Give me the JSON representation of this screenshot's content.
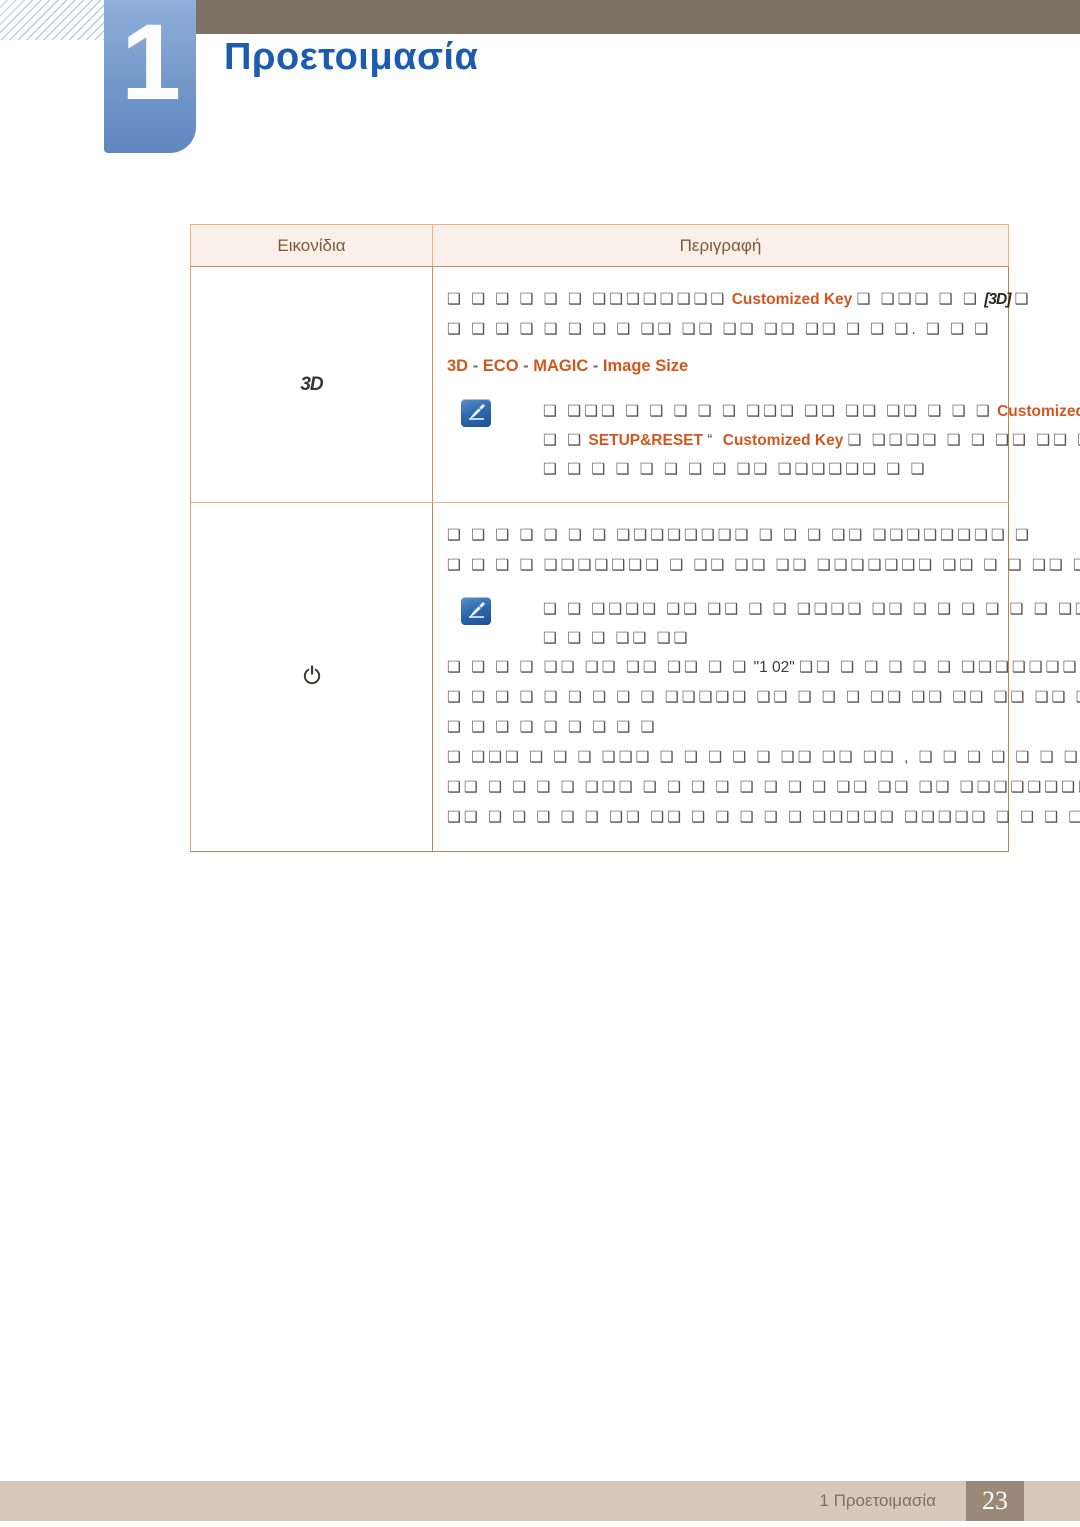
{
  "header": {
    "chapter_number": "1",
    "chapter_title": "Προετοιμασία"
  },
  "table": {
    "columns": [
      "Εικονίδια",
      "Περιγραφή"
    ],
    "rows": [
      {
        "icon_name": "3d-logo-icon",
        "icon_label": "3D",
        "lines": [
          {
            "segments": [
              {
                "type": "tofu",
                "text": "❑ ❑ ❑ ❑ ❑ ❑ ❑❑❑❑❑❑❑❑"
              },
              {
                "type": "term",
                "text": "Customized Key"
              },
              {
                "type": "tofu",
                "text": "❑ ❑❑❑ ❑ ❑"
              },
              {
                "type": "brk3d",
                "text": "[3D]"
              },
              {
                "type": "tofu",
                "text": "❑"
              }
            ]
          },
          {
            "segments": [
              {
                "type": "tofu",
                "text": "❑ ❑ ❑ ❑ ❑ ❑ ❑ ❑ ❑❑ ❑❑ ❑❑ ❑❑ ❑❑ ❑ ❑ ❑. ❑ ❑ ❑"
              }
            ]
          }
        ],
        "menu_path": [
          {
            "type": "term",
            "text": "3D"
          },
          {
            "type": "dash",
            "text": " - "
          },
          {
            "type": "term",
            "text": "ECO"
          },
          {
            "type": "dash",
            "text": " - "
          },
          {
            "type": "term",
            "text": "MAGIC"
          },
          {
            "type": "dash",
            "text": " - "
          },
          {
            "type": "term",
            "text": "Image Size"
          }
        ],
        "note": {
          "icon_name": "note-pen-icon",
          "lines": [
            {
              "segments": [
                {
                  "type": "tofu",
                  "text": "❑ ❑❑❑ ❑ ❑ ❑ ❑ ❑ ❑❑❑ ❑❑ ❑❑ ❑❑ ❑ ❑ ❑"
                },
                {
                  "type": "term",
                  "text": "Customized Key"
                },
                {
                  "type": "tofu",
                  "text": "❑ ❑ ❑"
                }
              ]
            },
            {
              "segments": [
                {
                  "type": "tofu",
                  "text": "❑ ❑"
                },
                {
                  "type": "term",
                  "text": "SETUP&RESET"
                },
                {
                  "type": "tofu",
                  "text": " “ "
                },
                {
                  "type": "term",
                  "text": "Customized Key"
                },
                {
                  "type": "tofu",
                  "text": "❑ ❑❑❑❑ ❑ ❑ ❑❑ ❑❑ ❑❑ ❑"
                }
              ]
            },
            {
              "segments": [
                {
                  "type": "tofu",
                  "text": "❑ ❑ ❑ ❑ ❑ ❑ ❑ ❑ ❑❑ ❑❑❑❑❑❑ ❑ ❑"
                }
              ]
            }
          ]
        }
      },
      {
        "icon_name": "power-button-icon",
        "icon_label": "",
        "lines": [
          {
            "segments": [
              {
                "type": "tofu",
                "text": "❑ ❑ ❑ ❑ ❑ ❑ ❑ ❑❑❑❑❑❑❑❑ ❑ ❑ ❑ ❑❑ ❑❑❑❑❑❑❑❑ ❑"
              }
            ]
          },
          {
            "segments": [
              {
                "type": "tofu",
                "text": "❑ ❑ ❑ ❑ ❑❑❑❑❑❑❑ ❑ ❑❑ ❑❑ ❑❑ ❑❑❑❑❑❑❑ ❑❑ ❑ ❑ ❑❑ ❑❑ ❑ ❑ ❑❑ ❑❑ ❑❑ ❑❑ ❑ ❑ ❑"
              }
            ]
          }
        ],
        "menu_path": [],
        "note": {
          "icon_name": "note-pen-icon",
          "lines": [
            {
              "segments": [
                {
                  "type": "tofu",
                  "text": "❑ ❑ ❑❑❑❑ ❑❑ ❑❑ ❑ ❑ ❑❑❑❑ ❑❑ ❑ ❑ ❑ ❑ ❑ ❑ ❑❑ ❑ ❑ ❑ ❑❑ ❑ ❑ ❑"
                }
              ]
            },
            {
              "segments": [
                {
                  "type": "tofu",
                  "text": "❑ ❑ ❑ ❑❑ ❑❑"
                }
              ]
            }
          ]
        },
        "extra_lines": [
          {
            "segments": [
              {
                "type": "tofu",
                "text": "❑ ❑ ❑ ❑ ❑❑ ❑❑ ❑❑ ❑❑ ❑ ❑"
              },
              {
                "type": "plain",
                "text": "\"1 02\""
              },
              {
                "type": "tofu",
                "text": "❑❑ ❑ ❑ ❑ ❑ ❑ ❑❑❑❑❑❑❑❑❑❑❑ ❑❑ ❑❑ ❑"
              }
            ]
          },
          {
            "segments": [
              {
                "type": "tofu",
                "text": "❑ ❑ ❑ ❑ ❑ ❑ ❑ ❑ ❑ ❑❑❑❑❑ ❑❑ ❑ ❑ ❑ ❑❑ ❑❑ ❑❑ ❑❑ ❑❑ ❑ ❑ ❑ ❑ ❑ ❑ ❑"
              }
            ]
          },
          {
            "segments": [
              {
                "type": "tofu",
                "text": "❑ ❑ ❑ ❑ ❑ ❑ ❑ ❑ ❑"
              }
            ]
          },
          {
            "segments": [
              {
                "type": "tofu",
                "text": "❑ ❑❑❑ ❑ ❑ ❑ ❑❑❑ ❑ ❑ ❑ ❑ ❑ ❑❑ ❑❑ ❑❑ , ❑ ❑ ❑ ❑ ❑ ❑ ❑ ❑ ❑"
              }
            ]
          },
          {
            "segments": [
              {
                "type": "tofu",
                "text": "❑❑ ❑ ❑ ❑ ❑ ❑❑❑ ❑ ❑ ❑ ❑ ❑ ❑ ❑ ❑ ❑❑ ❑❑ ❑❑ ❑❑❑❑❑❑❑❑❑"
              }
            ]
          },
          {
            "segments": [
              {
                "type": "tofu",
                "text": "❑❑ ❑ ❑ ❑ ❑ ❑ ❑❑ ❑❑ ❑ ❑ ❑ ❑ ❑ ❑❑❑❑❑ ❑❑❑❑❑ ❑ ❑ ❑ ❑ ❑ ❑"
              }
            ]
          }
        ]
      }
    ]
  },
  "footer": {
    "label": "1 Προετοιμασία",
    "page_number": "23"
  },
  "colors": {
    "accent_orange": "#d2571f",
    "chapter_blue": "#1b5cb0",
    "header_brown": "#7d7163",
    "table_border": "#e8b48a",
    "table_header_bg": "#fbefe9",
    "footer_bg": "#d6c9b8",
    "page_chip_bg": "#9a8878"
  }
}
